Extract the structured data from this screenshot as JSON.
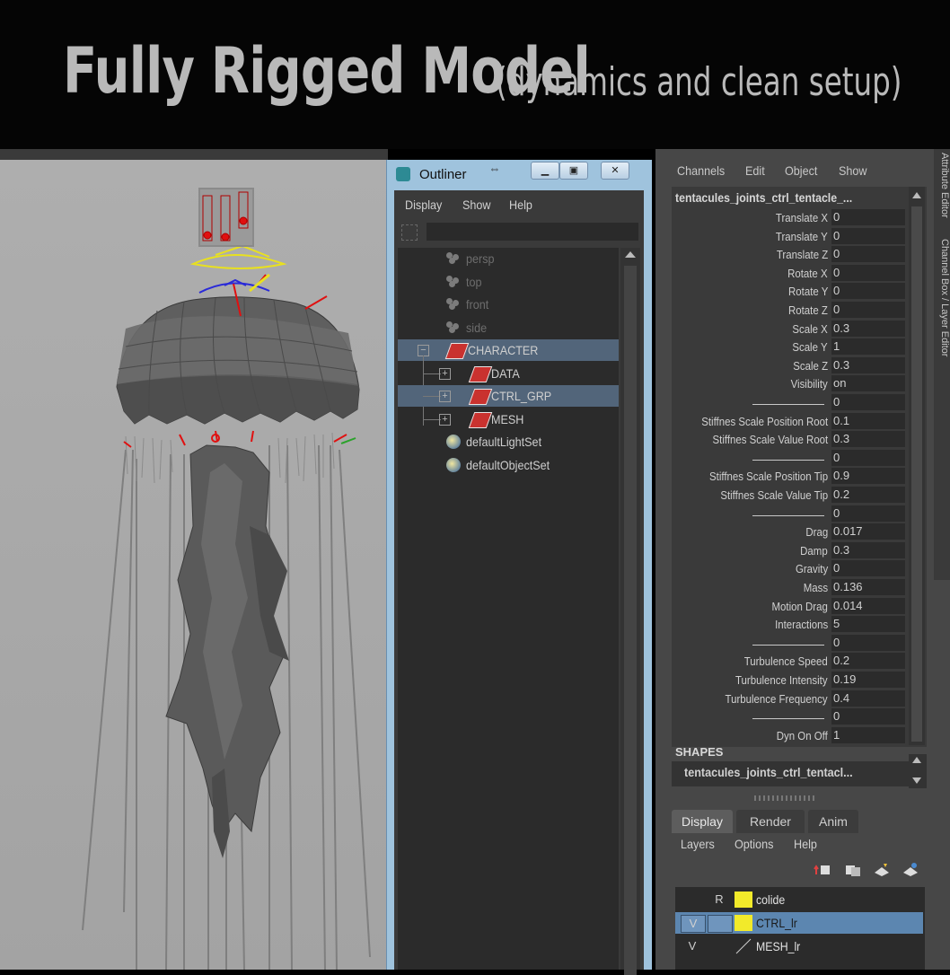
{
  "banner": {
    "title": "Fully Rigged Model",
    "subtitle": "(dynamics and clean setup)"
  },
  "outliner": {
    "title": "Outliner",
    "menu": [
      "Display",
      "Show",
      "Help"
    ],
    "items": [
      {
        "label": "persp",
        "type": "camera",
        "dim": true
      },
      {
        "label": "top",
        "type": "camera",
        "dim": true
      },
      {
        "label": "front",
        "type": "camera",
        "dim": true
      },
      {
        "label": "side",
        "type": "camera",
        "dim": true
      },
      {
        "label": "CHARACTER",
        "type": "transform",
        "selected": true
      },
      {
        "label": "DATA",
        "type": "transform"
      },
      {
        "label": "CTRL_GRP",
        "type": "transform",
        "selected": true
      },
      {
        "label": "MESH",
        "type": "transform"
      },
      {
        "label": "defaultLightSet",
        "type": "set"
      },
      {
        "label": "defaultObjectSet",
        "type": "set"
      }
    ]
  },
  "channel_box": {
    "menu": [
      "Channels",
      "Edit",
      "Object",
      "Show"
    ],
    "side_tabs": [
      "Attribute Editor",
      "Channel Box / Layer Editor"
    ],
    "node_name": "tentacules_joints_ctrl_tentacle_...",
    "attributes": [
      {
        "name": "Translate X",
        "value": "0"
      },
      {
        "name": "Translate Y",
        "value": "0"
      },
      {
        "name": "Translate Z",
        "value": "0"
      },
      {
        "name": "Rotate X",
        "value": "0"
      },
      {
        "name": "Rotate Y",
        "value": "0"
      },
      {
        "name": "Rotate Z",
        "value": "0"
      },
      {
        "name": "Scale X",
        "value": "0.3"
      },
      {
        "name": "Scale Y",
        "value": "1"
      },
      {
        "name": "Scale Z",
        "value": "0.3"
      },
      {
        "name": "Visibility",
        "value": "on"
      },
      {
        "name": "",
        "value": "0",
        "separator": true
      },
      {
        "name": "Stiffnes Scale Position Root",
        "value": "0.1"
      },
      {
        "name": "Stiffnes Scale Value Root",
        "value": "0.3"
      },
      {
        "name": "",
        "value": "0",
        "separator": true
      },
      {
        "name": "Stiffnes Scale Position Tip",
        "value": "0.9"
      },
      {
        "name": "Stiffnes Scale Value Tip",
        "value": "0.2"
      },
      {
        "name": "",
        "value": "0",
        "separator": true
      },
      {
        "name": "Drag",
        "value": "0.017"
      },
      {
        "name": "Damp",
        "value": "0.3"
      },
      {
        "name": "Gravity",
        "value": "0"
      },
      {
        "name": "Mass",
        "value": "0.136"
      },
      {
        "name": "Motion Drag",
        "value": "0.014"
      },
      {
        "name": "Interactions",
        "value": "5"
      },
      {
        "name": "",
        "value": "0",
        "separator": true
      },
      {
        "name": "Turbulence Speed",
        "value": "0.2"
      },
      {
        "name": "Turbulence Intensity",
        "value": "0.19"
      },
      {
        "name": "Turbulence Frequency",
        "value": "0.4"
      },
      {
        "name": "",
        "value": "0",
        "separator": true
      },
      {
        "name": "Dyn On Off",
        "value": "1"
      }
    ],
    "shapes_header": "SHAPES",
    "shapes_node": "tentacules_joints_ctrl_tentacl..."
  },
  "layer_editor": {
    "tabs": [
      "Display",
      "Render",
      "Anim"
    ],
    "active_tab": "Display",
    "menu": [
      "Layers",
      "Options",
      "Help"
    ],
    "layers": [
      {
        "visible": "",
        "ref": "R",
        "color": "#f2ea2a",
        "name": "colide"
      },
      {
        "visible": "V",
        "ref": "",
        "color": "#f2ea2a",
        "name": "CTRL_lr",
        "selected": true
      },
      {
        "visible": "V",
        "ref": "",
        "color": "none",
        "name": "MESH_lr"
      }
    ]
  },
  "colors": {
    "viewport_bg": "#a9a9a9",
    "selection": "#52657a",
    "layer_selection": "#5c86b0",
    "control_yellow": "#e8e020",
    "control_red": "#e01010",
    "control_blue": "#2a2ad8"
  }
}
